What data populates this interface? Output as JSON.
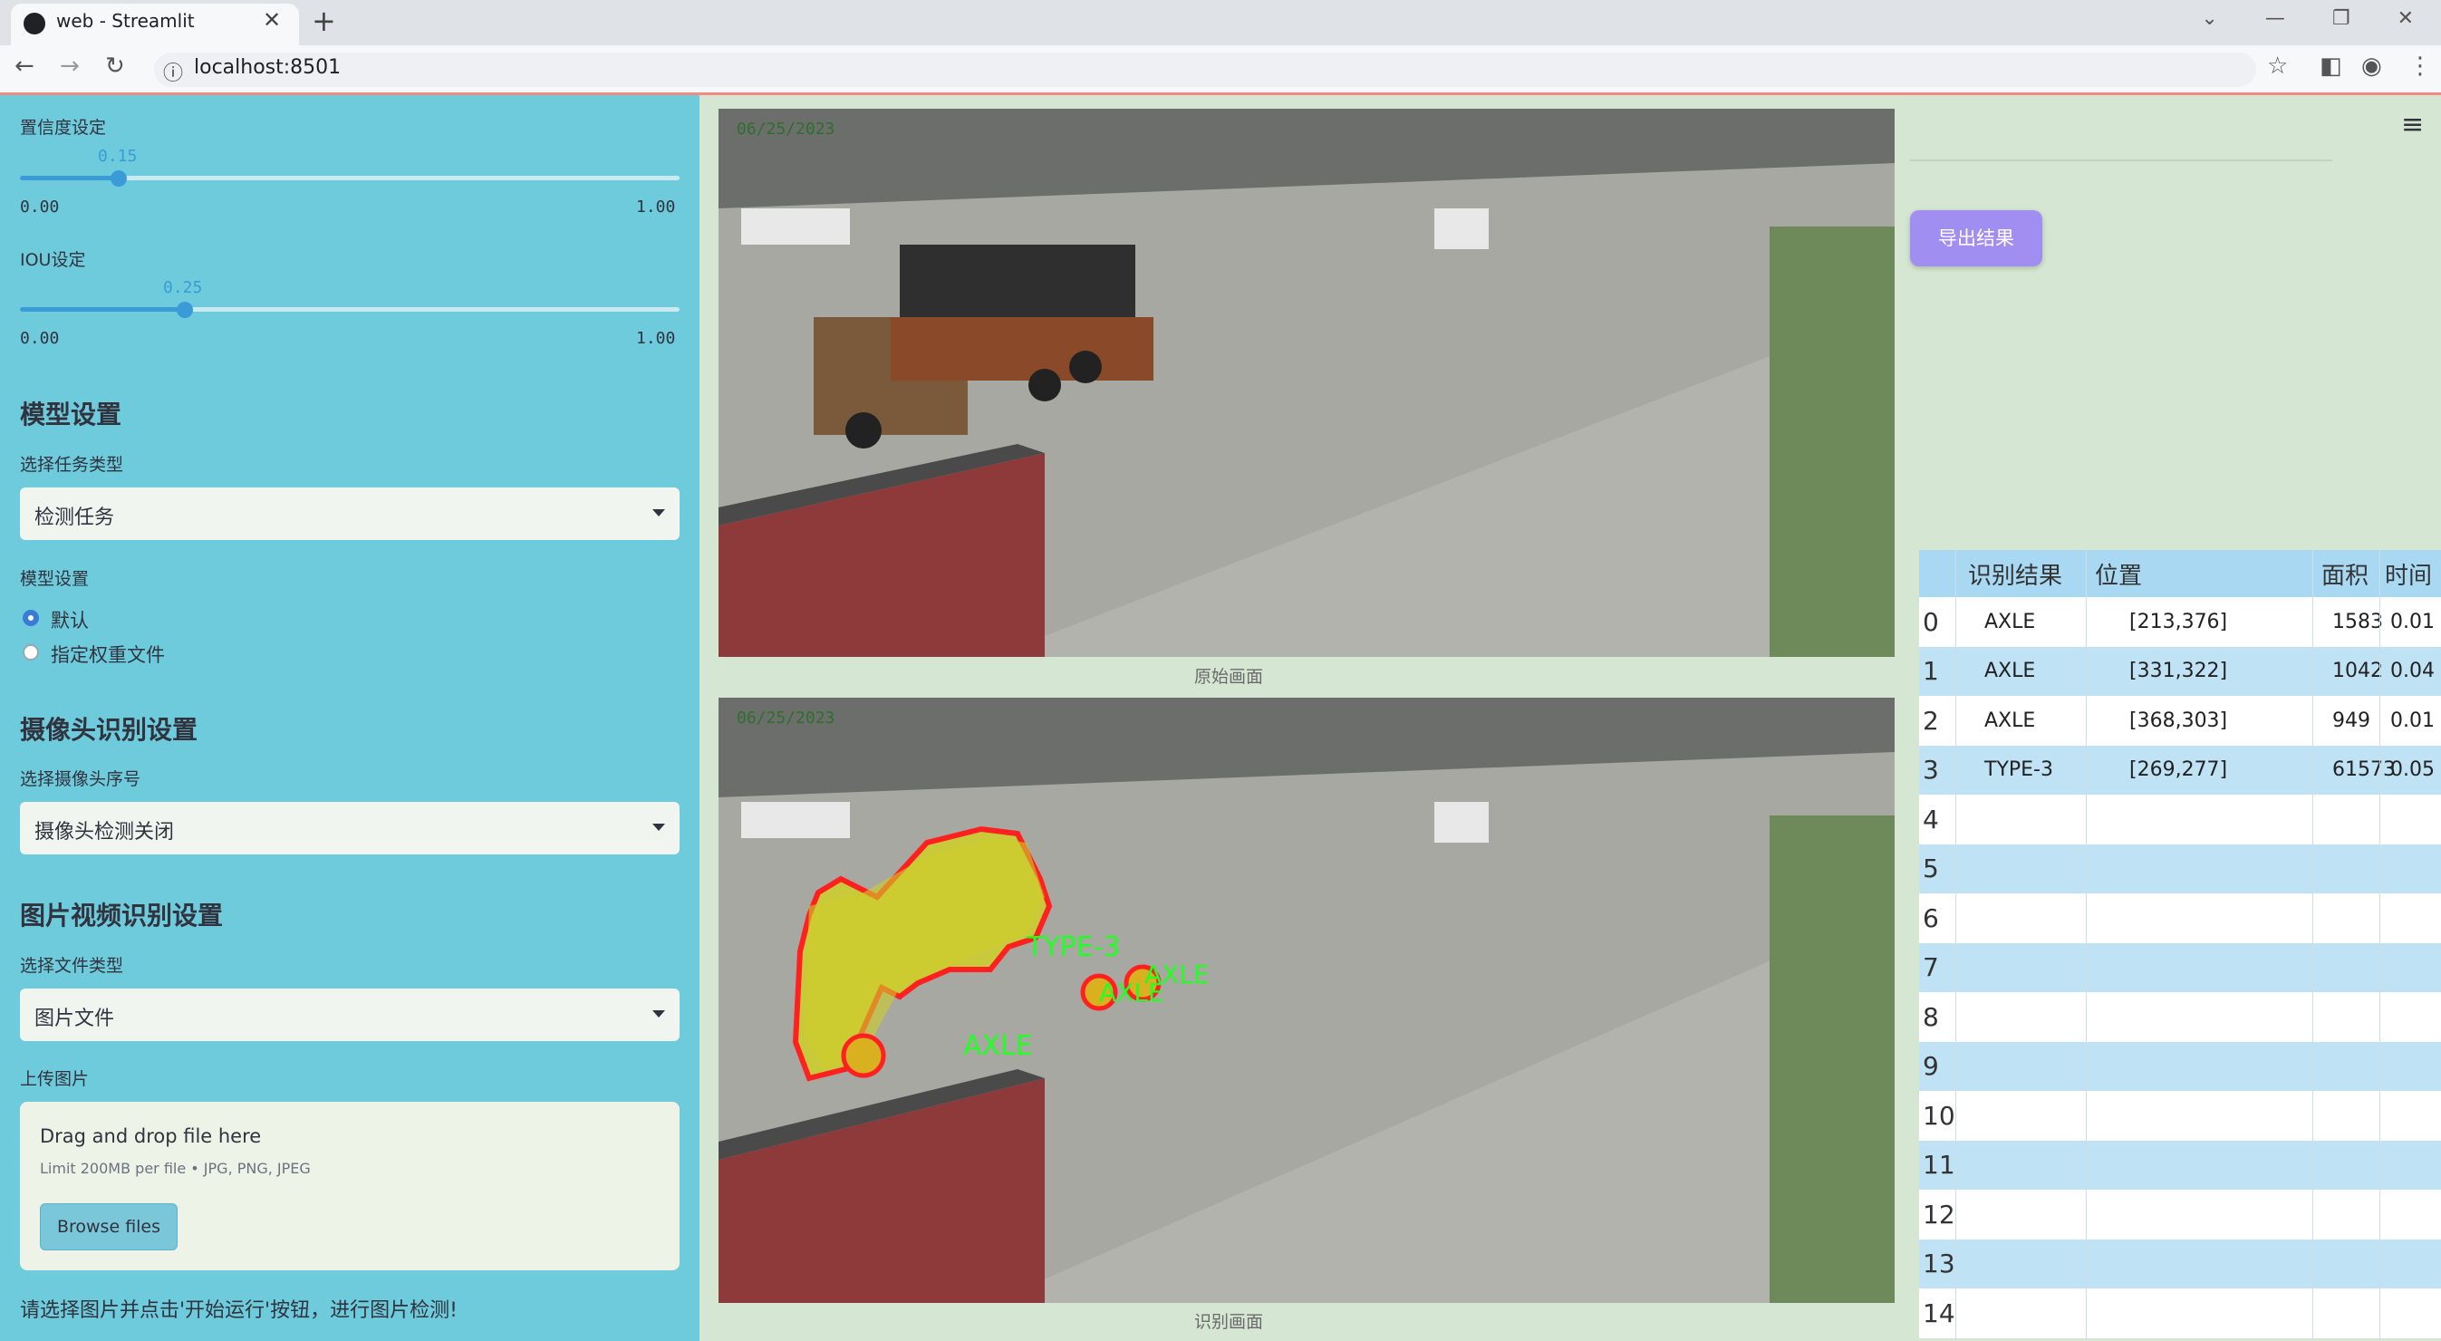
{
  "browser": {
    "tab_title": "web - Streamlit",
    "url": "localhost:8501"
  },
  "sidebar": {
    "confidence": {
      "label": "置信度设定",
      "value": "0.15",
      "value_num": 0.15,
      "min": "0.00",
      "max": "1.00"
    },
    "iou": {
      "label": "IOU设定",
      "value": "0.25",
      "value_num": 0.25,
      "min": "0.00",
      "max": "1.00"
    },
    "model_header": "模型设置",
    "task_type_label": "选择任务类型",
    "task_type_value": "检测任务",
    "model_settings_label": "模型设置",
    "radio_options": [
      "默认",
      "指定权重文件"
    ],
    "radio_selected": 0,
    "camera_header": "摄像头识别设置",
    "camera_index_label": "选择摄像头序号",
    "camera_value": "摄像头检测关闭",
    "media_header": "图片视频识别设置",
    "file_type_label": "选择文件类型",
    "file_type_value": "图片文件",
    "upload_label": "上传图片",
    "uploader_title": "Drag and drop file here",
    "uploader_limit": "Limit 200MB per file • JPG, PNG, JPEG",
    "browse_button": "Browse files",
    "hint": "请选择图片并点击'开始运行'按钮，进行图片检测!"
  },
  "main": {
    "original_caption": "原始画面",
    "detected_caption": "识别画面",
    "export_button": "导出结果",
    "overlay_labels": [
      "TYPE-3",
      "AXLE",
      "AXLE",
      "AXLE"
    ],
    "image_text": "06/25/2023"
  },
  "table": {
    "headers": [
      "识别结果",
      "位置",
      "面积",
      "时间"
    ],
    "rows": [
      {
        "idx": "0",
        "result": "AXLE",
        "pos": "[213,376]",
        "area": "1583",
        "time": "0.01"
      },
      {
        "idx": "1",
        "result": "AXLE",
        "pos": "[331,322]",
        "area": "1042",
        "time": "0.04"
      },
      {
        "idx": "2",
        "result": "AXLE",
        "pos": "[368,303]",
        "area": "949",
        "time": "0.01"
      },
      {
        "idx": "3",
        "result": "TYPE-3",
        "pos": "[269,277]",
        "area": "61573",
        "time": "0.05"
      },
      {
        "idx": "4",
        "result": "",
        "pos": "",
        "area": "",
        "time": ""
      },
      {
        "idx": "5",
        "result": "",
        "pos": "",
        "area": "",
        "time": ""
      },
      {
        "idx": "6",
        "result": "",
        "pos": "",
        "area": "",
        "time": ""
      },
      {
        "idx": "7",
        "result": "",
        "pos": "",
        "area": "",
        "time": ""
      },
      {
        "idx": "8",
        "result": "",
        "pos": "",
        "area": "",
        "time": ""
      },
      {
        "idx": "9",
        "result": "",
        "pos": "",
        "area": "",
        "time": ""
      },
      {
        "idx": "10",
        "result": "",
        "pos": "",
        "area": "",
        "time": ""
      },
      {
        "idx": "11",
        "result": "",
        "pos": "",
        "area": "",
        "time": ""
      },
      {
        "idx": "12",
        "result": "",
        "pos": "",
        "area": "",
        "time": ""
      },
      {
        "idx": "13",
        "result": "",
        "pos": "",
        "area": "",
        "time": ""
      },
      {
        "idx": "14",
        "result": "",
        "pos": "",
        "area": "",
        "time": ""
      }
    ]
  },
  "colors": {
    "sidebar_bg": "#6ecbdc",
    "main_bg": "#d5e6d3",
    "accent": "#3a9bd6",
    "export_btn": "#a08ef0",
    "mask_fill": "#cfcf2a",
    "mask_outline": "#ff2020",
    "label_text": "#22ff22"
  }
}
